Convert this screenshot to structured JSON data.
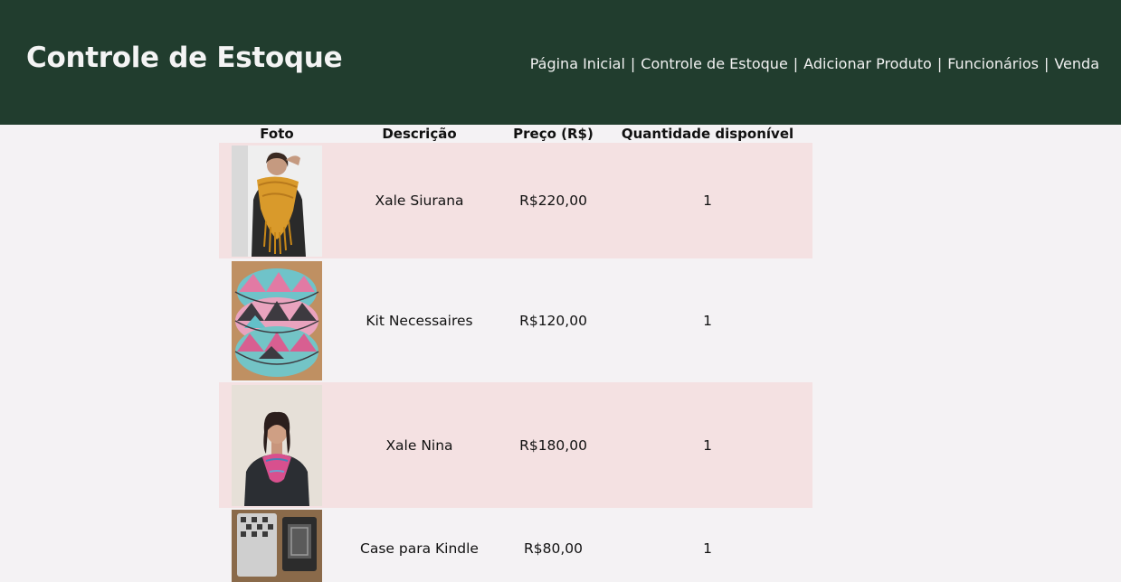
{
  "header": {
    "title": "Controle de Estoque",
    "nav": [
      {
        "label": "Página Inicial"
      },
      {
        "label": "Controle de Estoque"
      },
      {
        "label": "Adicionar Produto"
      },
      {
        "label": "Funcionários"
      },
      {
        "label": "Venda"
      }
    ],
    "separator": "|"
  },
  "table": {
    "columns": [
      "Foto",
      "Descrição",
      "Preço (R$)",
      "Quantidade disponível"
    ],
    "rows": [
      {
        "description": "Xale Siurana",
        "price": "R$220,00",
        "quantity": "1",
        "photo": "product-photo-yellow-shawl"
      },
      {
        "description": "Kit Necessaires",
        "price": "R$120,00",
        "quantity": "1",
        "photo": "product-photo-pouches"
      },
      {
        "description": "Xale Nina",
        "price": "R$180,00",
        "quantity": "1",
        "photo": "product-photo-pink-shawl"
      },
      {
        "description": "Case para Kindle",
        "price": "R$80,00",
        "quantity": "1",
        "photo": "product-photo-kindle-case"
      }
    ]
  },
  "colors": {
    "header_bg": "#213d2e",
    "page_bg": "#f4f2f4",
    "row_highlight": "#f4e1e2"
  }
}
